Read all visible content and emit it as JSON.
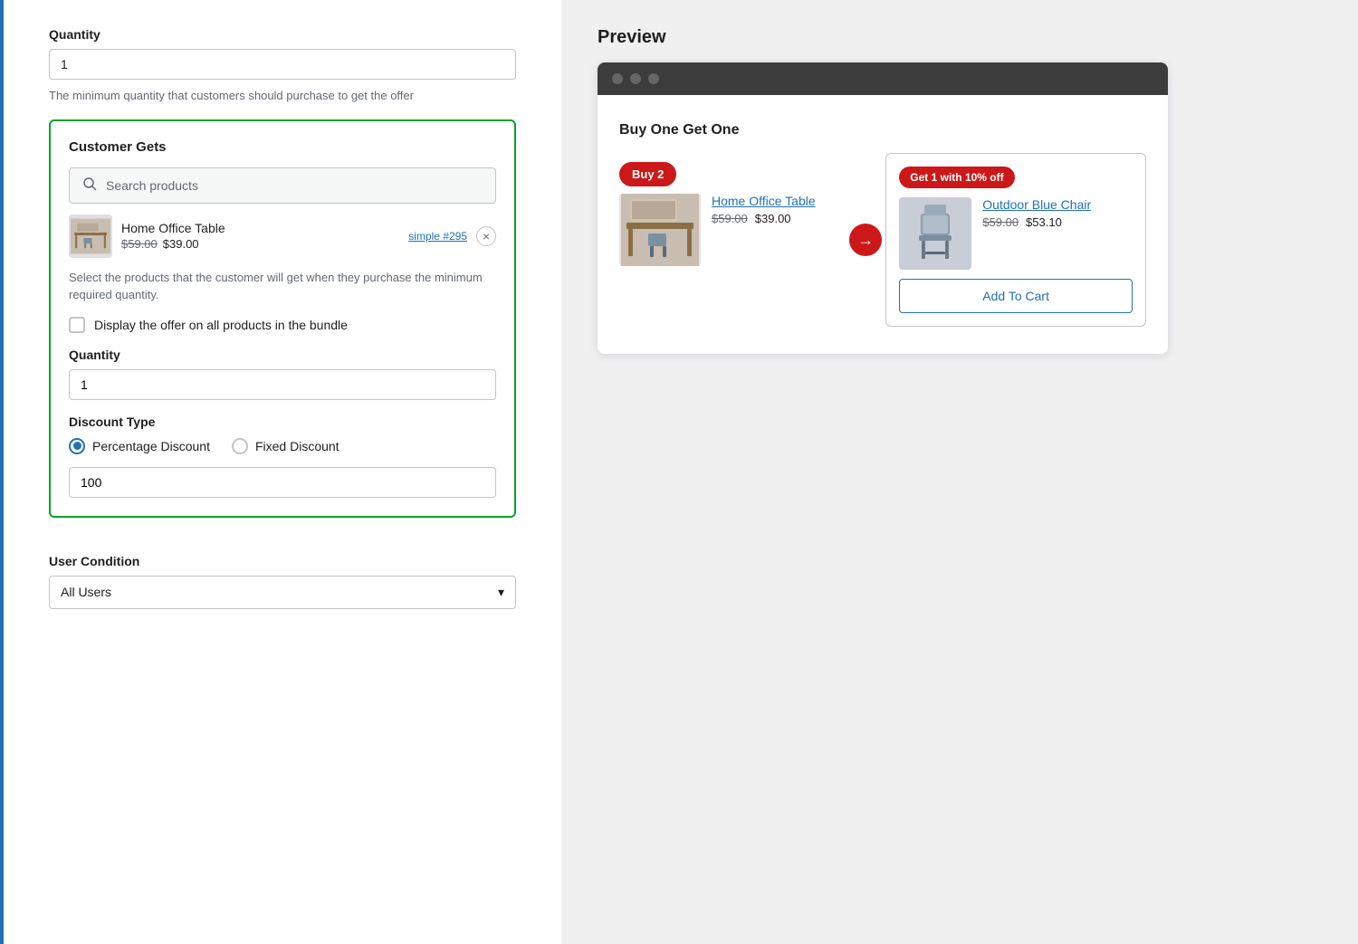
{
  "left": {
    "quantity_top_label": "Quantity",
    "quantity_top_value": "1",
    "quantity_top_helper": "The minimum quantity that customers should purchase to get the offer",
    "customer_gets": {
      "title": "Customer Gets",
      "search_placeholder": "Search products",
      "product": {
        "name": "Home Office Table",
        "price_old": "$59.00",
        "price_new": "$39.00",
        "link_text": "simple #295"
      },
      "remove_btn": "×",
      "select_helper": "Select the products that the customer will get when they purchase the minimum required quantity.",
      "checkbox_label": "Display the offer on all products in the bundle",
      "quantity_label": "Quantity",
      "quantity_value": "1",
      "discount_type_label": "Discount Type",
      "radio_option_1": "Percentage Discount",
      "radio_option_2": "Fixed Discount",
      "discount_value": "100"
    },
    "user_condition": {
      "label": "User Condition",
      "selected": "All Users",
      "chevron": "▾"
    }
  },
  "right": {
    "preview_title": "Preview",
    "bogo_label": "Buy One Get One",
    "buy_badge": "Buy 2",
    "get_badge": "Get 1 with 10% off",
    "product_left": {
      "name": "Home Office Table",
      "price_old": "$59.00",
      "price_new": "$39.00"
    },
    "product_right": {
      "name": "Outdoor Blue Chair",
      "price_old": "$59.00",
      "price_new": "$53.10"
    },
    "add_to_cart": "Add To Cart",
    "arrow": "→"
  }
}
